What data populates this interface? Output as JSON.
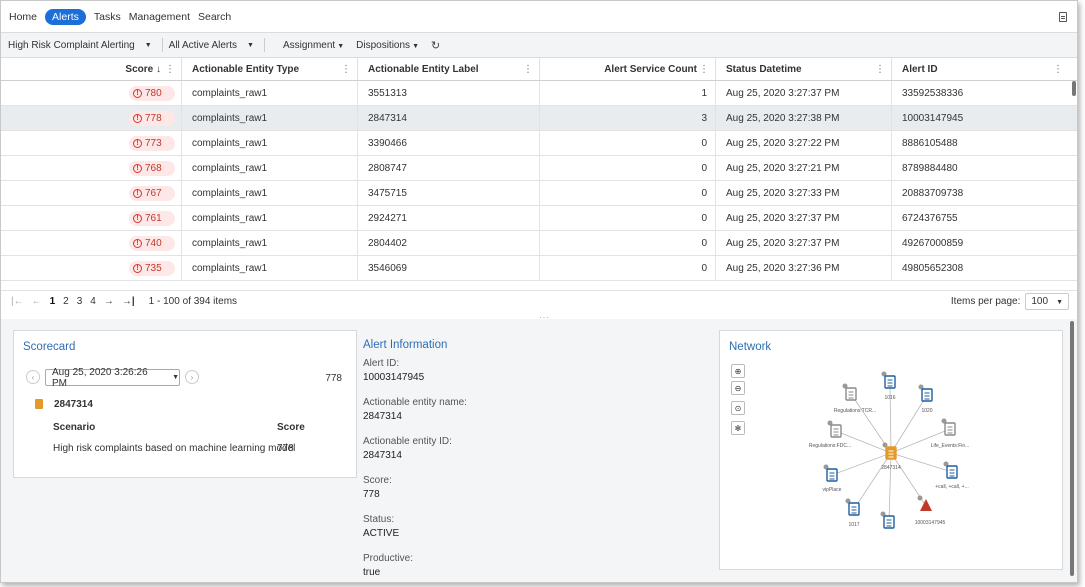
{
  "nav": {
    "items": [
      {
        "label": "Home",
        "active": false
      },
      {
        "label": "Alerts",
        "active": true
      },
      {
        "label": "Tasks",
        "active": false
      },
      {
        "label": "Management",
        "active": false
      },
      {
        "label": "Search",
        "active": false
      }
    ]
  },
  "toolbar": {
    "queue_select": "High Risk Complaint Alerting",
    "filter_select": "All Active Alerts",
    "assignment_label": "Assignment",
    "dispositions_label": "Dispositions"
  },
  "grid": {
    "columns": {
      "score": "Score ↓",
      "type": "Actionable Entity Type",
      "label": "Actionable Entity Label",
      "count": "Alert Service Count",
      "date": "Status Datetime",
      "id": "Alert ID"
    },
    "rows": [
      {
        "score": "780",
        "type": "complaints_raw1",
        "label": "3551313",
        "count": "1",
        "date": "Aug 25, 2020 3:27:37 PM",
        "id": "33592538336",
        "selected": false
      },
      {
        "score": "778",
        "type": "complaints_raw1",
        "label": "2847314",
        "count": "3",
        "date": "Aug 25, 2020 3:27:38 PM",
        "id": "10003147945",
        "selected": true
      },
      {
        "score": "773",
        "type": "complaints_raw1",
        "label": "3390466",
        "count": "0",
        "date": "Aug 25, 2020 3:27:22 PM",
        "id": "8886105488",
        "selected": false
      },
      {
        "score": "768",
        "type": "complaints_raw1",
        "label": "2808747",
        "count": "0",
        "date": "Aug 25, 2020 3:27:21 PM",
        "id": "8789884480",
        "selected": false
      },
      {
        "score": "767",
        "type": "complaints_raw1",
        "label": "3475715",
        "count": "0",
        "date": "Aug 25, 2020 3:27:33 PM",
        "id": "20883709738",
        "selected": false
      },
      {
        "score": "761",
        "type": "complaints_raw1",
        "label": "2924271",
        "count": "0",
        "date": "Aug 25, 2020 3:27:37 PM",
        "id": "6724376755",
        "selected": false
      },
      {
        "score": "740",
        "type": "complaints_raw1",
        "label": "2804402",
        "count": "0",
        "date": "Aug 25, 2020 3:27:37 PM",
        "id": "49267000859",
        "selected": false
      },
      {
        "score": "735",
        "type": "complaints_raw1",
        "label": "3546069",
        "count": "0",
        "date": "Aug 25, 2020 3:27:36 PM",
        "id": "49805652308",
        "selected": false
      }
    ]
  },
  "pager": {
    "pages": [
      "1",
      "2",
      "3",
      "4"
    ],
    "range_text": "1 - 100 of 394 items",
    "items_per_page_label": "Items per page:",
    "items_per_page_value": "100"
  },
  "scorecard": {
    "title": "Scorecard",
    "date": "Aug 25, 2020 3:26:26 PM",
    "total_score": "778",
    "entity_label": "2847314",
    "col_scenario": "Scenario",
    "col_score": "Score",
    "scenario": "High risk complaints based on machine learning model",
    "scenario_score": "778"
  },
  "alert_info": {
    "title": "Alert Information",
    "fields": [
      {
        "label": "Alert ID:",
        "value": "10003147945"
      },
      {
        "label": "Actionable entity name:",
        "value": "2847314"
      },
      {
        "label": "Actionable entity ID:",
        "value": "2847314"
      },
      {
        "label": "Score:",
        "value": "778"
      },
      {
        "label": "Status:",
        "value": "ACTIVE"
      },
      {
        "label": "Productive:",
        "value": "true"
      }
    ]
  },
  "network": {
    "title": "Network",
    "center_label": "2847314",
    "nodes": [
      {
        "label": "1016",
        "kind": "blue-doc"
      },
      {
        "label": "1020",
        "kind": "blue-doc"
      },
      {
        "label": "Life_Events:Fin...",
        "kind": "gray-doc"
      },
      {
        "label": "+call, +call, +...",
        "kind": "blue-grid"
      },
      {
        "label": "10003147945",
        "kind": "red-alert"
      },
      {
        "label": "",
        "kind": "teal-building"
      },
      {
        "label": "1017",
        "kind": "blue-doc"
      },
      {
        "label": "vipPlace",
        "kind": "blue-pin"
      },
      {
        "label": "Regulations:FDC...",
        "kind": "gray-doc"
      },
      {
        "label": "Regulations:TCR...",
        "kind": "gray-doc"
      }
    ],
    "colors": {
      "center": "#e39a2a",
      "blue": "#1f5f9e",
      "alert": "#c0392b",
      "gray": "#8a8a8a"
    }
  }
}
